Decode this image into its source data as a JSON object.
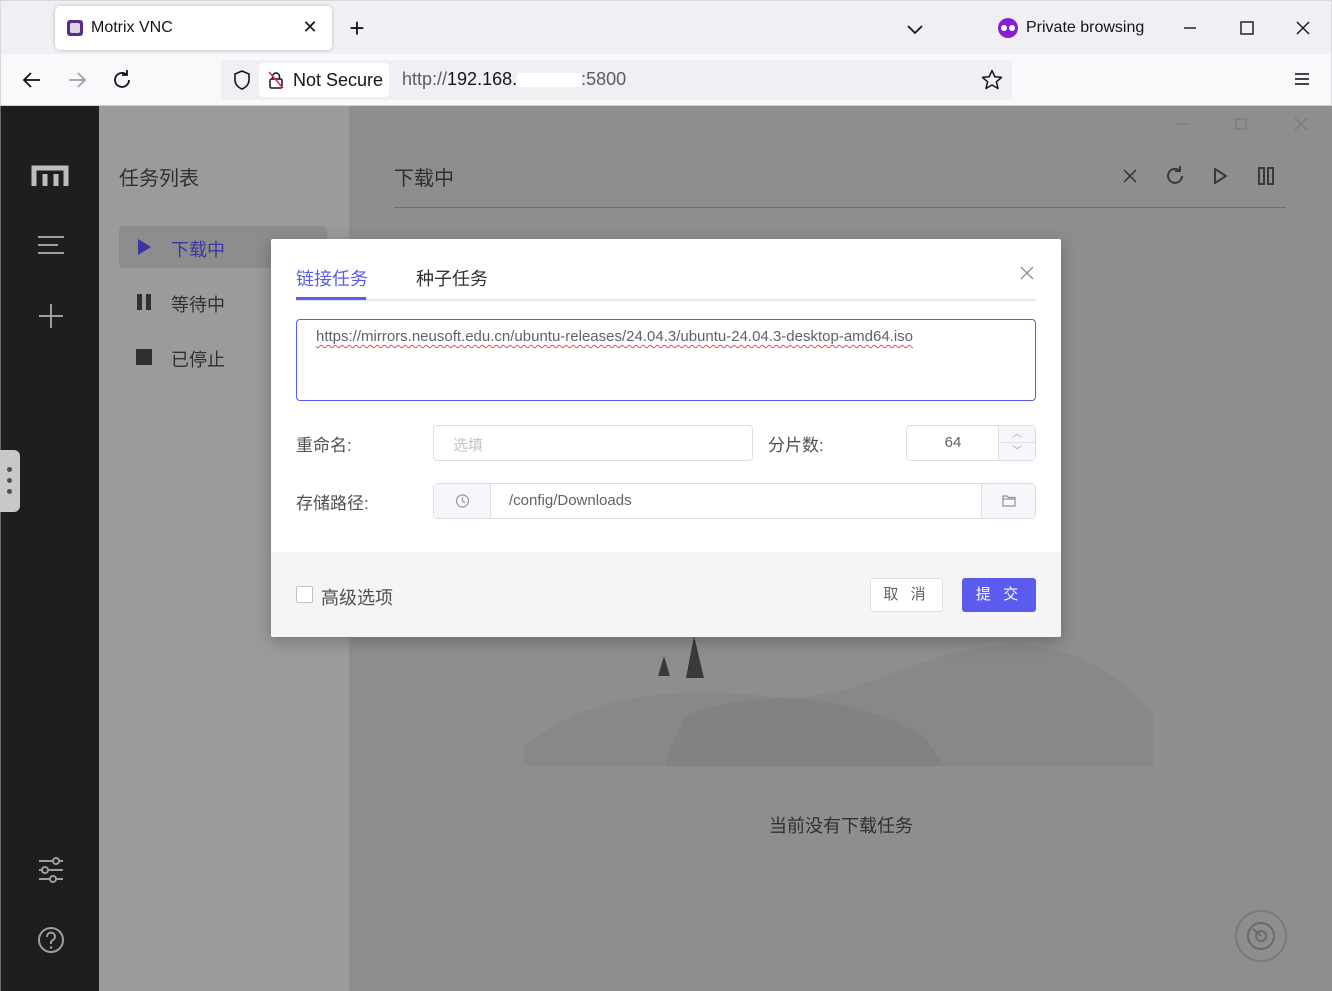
{
  "browser": {
    "tab_title": "Motrix VNC",
    "private_label": "Private browsing",
    "not_secure": "Not Secure",
    "url_prefix": "http://",
    "url_host": "192.168.",
    "url_suffix": ":5800"
  },
  "panel": {
    "title": "任务列表",
    "items": [
      {
        "label": "下载中",
        "icon": "play-icon",
        "active": true
      },
      {
        "label": "等待中",
        "icon": "pause-icon",
        "active": false
      },
      {
        "label": "已停止",
        "icon": "stop-icon",
        "active": false
      }
    ]
  },
  "main": {
    "title": "下载中",
    "empty_text": "当前没有下载任务"
  },
  "dialog": {
    "tabs": [
      "链接任务",
      "种子任务"
    ],
    "url_value": "https://mirrors.neusoft.edu.cn/ubuntu-releases/24.04.3/ubuntu-24.04.3-desktop-amd64.iso",
    "rename_label": "重命名:",
    "rename_placeholder": "选填",
    "split_label": "分片数:",
    "split_value": "64",
    "path_label": "存储路径:",
    "path_value": "/config/Downloads",
    "advanced_label": "高级选项",
    "cancel_label": "取 消",
    "submit_label": "提 交"
  },
  "colors": {
    "accent": "#5b5bf0",
    "sidebar": "#1e1e1e",
    "private_purple": "#8c1cd0"
  }
}
